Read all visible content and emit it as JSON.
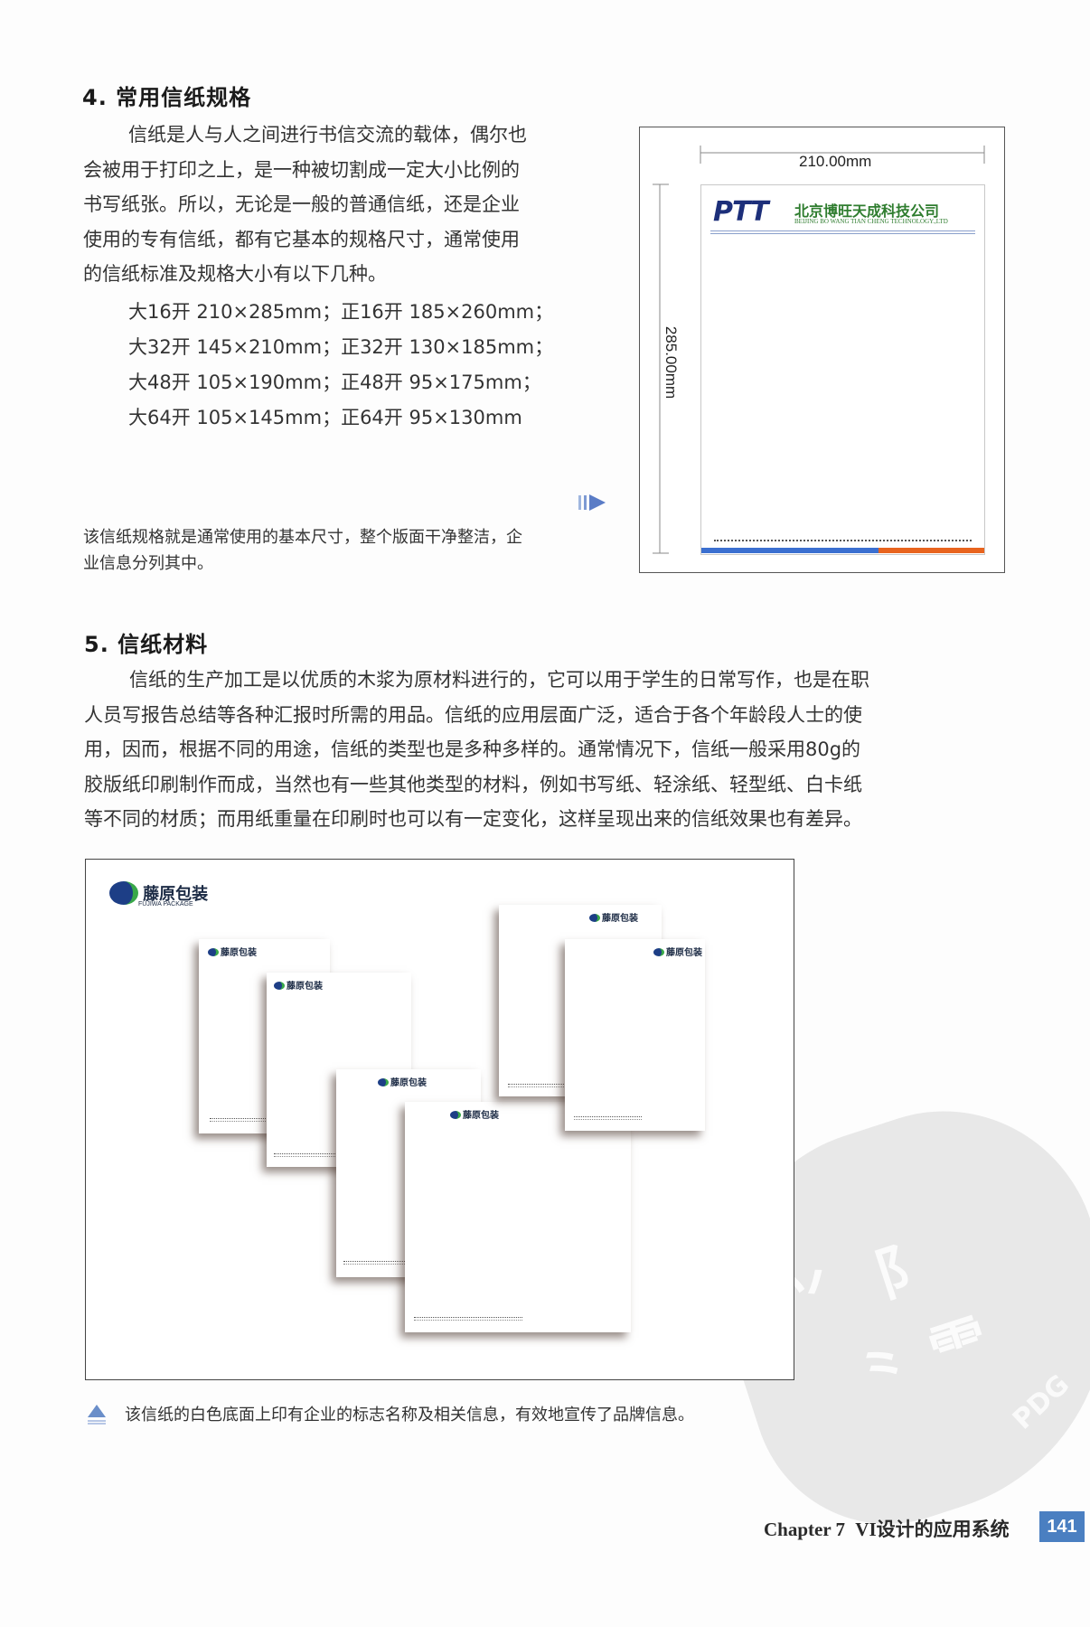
{
  "section4": {
    "heading": "4. 常用信纸规格",
    "para_lines": [
      "信纸是人与人之间进行书信交流的载体，偶尔也",
      "会被用于打印之上，是一种被切割成一定大小比例的",
      "书写纸张。所以，无论是一般的普通信纸，还是企业",
      "使用的专有信纸，都有它基本的规格尺寸，通常使用",
      "的信纸标准及规格大小有以下几种。"
    ],
    "specs": [
      "大16开 210×285mm；正16开 185×260mm；",
      "大32开 145×210mm；正32开 130×185mm；",
      "大48开 105×190mm；正48开 95×175mm；",
      "大64开 105×145mm；正64开 95×130mm"
    ],
    "caption_lines": [
      "该信纸规格就是通常使用的基本尺寸，整个版面干净整洁，企",
      "业信息分列其中。"
    ]
  },
  "figure1": {
    "width_label": "210.00mm",
    "height_label": "285.00mm",
    "logo_mark": "PTT",
    "company_cn": "北京博旺天成科技公司",
    "company_en": "BEIJING BO WANG TIAN CHENG TECHNOLOGY.,LTD"
  },
  "section5": {
    "heading": "5. 信纸材料",
    "para_lines": [
      "信纸的生产加工是以优质的木浆为原材料进行的，它可以用于学生的日常写作，也是在职",
      "人员写报告总结等各种汇报时所需的用品。信纸的应用层面广泛，适合于各个年龄段人士的使",
      "用，因而，根据不同的用途，信纸的类型也是多种多样的。通常情况下，信纸一般采用80g的",
      "胶版纸印刷制作而成，当然也有一些其他类型的材料，例如书写纸、轻涂纸、轻型纸、白卡纸",
      "等不同的材质；而用纸重量在印刷时也可以有一定变化，这样呈现出来的信纸效果也有差异。"
    ],
    "caption": "该信纸的白色底面上印有企业的标志名称及相关信息，有效地宣传了品牌信息。"
  },
  "figure2": {
    "brand_cn": "藤原包装",
    "brand_en": "FUJIWA PACKAGE",
    "paper_logo": "藤原包装"
  },
  "watermark": "PDG",
  "footer": {
    "chapter": "Chapter 7",
    "title": "VI设计的应用系统",
    "page_number": "141"
  },
  "colors": {
    "footer_page_bg": "#4a7fc1",
    "ptt_blue": "#1d2f7a",
    "company_green": "#2f7d2f",
    "bar_blue": "#3b6fd0",
    "bar_orange": "#e8641e",
    "caption_triangle": "#6a8ec9"
  }
}
